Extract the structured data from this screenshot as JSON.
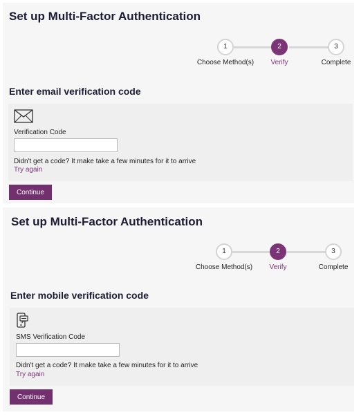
{
  "email_panel": {
    "title": "Set up Multi-Factor Authentication",
    "steps": [
      {
        "number": "1",
        "label": "Choose Method(s)"
      },
      {
        "number": "2",
        "label": "Verify"
      },
      {
        "number": "3",
        "label": "Complete"
      }
    ],
    "active_step": 2,
    "section_title": "Enter email verification code",
    "icon": "envelope-icon",
    "field_label": "Verification Code",
    "field_value": "",
    "hint": "Didn't get a code? It make take a few minutes for it to arrive",
    "retry_label": "Try again",
    "continue_label": "Continue"
  },
  "mobile_panel": {
    "title": "Set up Multi-Factor Authentication",
    "steps": [
      {
        "number": "1",
        "label": "Choose Method(s)"
      },
      {
        "number": "2",
        "label": "Verify"
      },
      {
        "number": "3",
        "label": "Complete"
      }
    ],
    "active_step": 2,
    "section_title": "Enter mobile verification code",
    "icon": "phone-message-icon",
    "field_label": "SMS Verification Code",
    "field_value": "",
    "hint": "Didn't get a code? It make take a few minutes for it to arrive",
    "retry_label": "Try again",
    "continue_label": "Continue"
  },
  "colors": {
    "accent": "#7b3577",
    "button": "#73306f",
    "panel_bg": "#f6f6f7",
    "card_bg": "#efeff0"
  }
}
